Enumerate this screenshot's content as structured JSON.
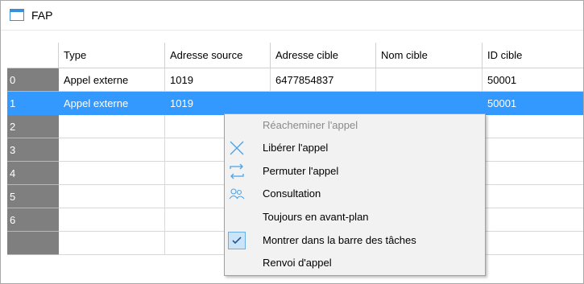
{
  "window": {
    "title": "FAP",
    "accent": "#3a8fd8"
  },
  "table": {
    "columns": [
      "Type",
      "Adresse source",
      "Adresse cible",
      "Nom cible",
      "ID cible"
    ],
    "rows": [
      {
        "index": "0",
        "cells": [
          "Appel externe",
          "1019",
          "6477854837",
          "",
          "50001"
        ]
      },
      {
        "index": "1",
        "cells": [
          "Appel externe",
          "1019",
          "",
          "",
          "50001"
        ],
        "selected": true
      },
      {
        "index": "2",
        "cells": [
          "",
          "",
          "",
          "",
          ""
        ]
      },
      {
        "index": "3",
        "cells": [
          "",
          "",
          "",
          "",
          ""
        ]
      },
      {
        "index": "4",
        "cells": [
          "",
          "",
          "",
          "",
          ""
        ]
      },
      {
        "index": "5",
        "cells": [
          "",
          "",
          "",
          "",
          ""
        ]
      },
      {
        "index": "6",
        "cells": [
          "",
          "",
          "",
          "",
          ""
        ]
      }
    ],
    "selection_color": "#3399ff"
  },
  "context_menu": {
    "items": [
      {
        "label": "Réacheminer l'appel",
        "icon": "",
        "disabled": true
      },
      {
        "label": "Libérer l'appel",
        "icon": "release-x-icon"
      },
      {
        "label": "Permuter l'appel",
        "icon": "swap-arrows-icon"
      },
      {
        "label": "Consultation",
        "icon": "people-icon"
      },
      {
        "label": "Toujours en avant-plan",
        "icon": ""
      },
      {
        "label": "Montrer dans la barre des tâches",
        "icon": "checkmark-icon",
        "checked": true
      },
      {
        "label": "Renvoi d'appel",
        "icon": ""
      }
    ]
  }
}
